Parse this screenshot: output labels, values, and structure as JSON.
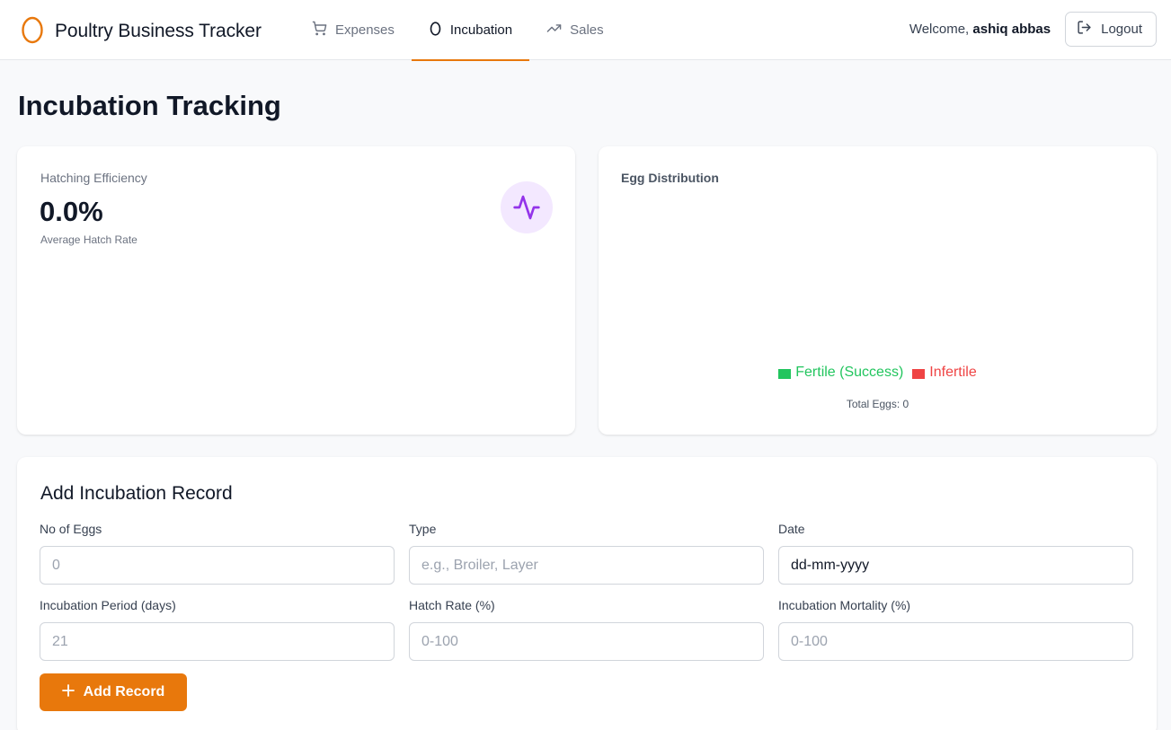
{
  "app": {
    "title": "Poultry Business Tracker"
  },
  "nav": {
    "items": [
      {
        "label": "Expenses",
        "icon": "cart-icon"
      },
      {
        "label": "Incubation",
        "icon": "egg-icon",
        "active": true
      },
      {
        "label": "Sales",
        "icon": "trending-up-icon"
      }
    ]
  },
  "user": {
    "welcome_prefix": "Welcome,",
    "name": "ashiq abbas",
    "logout_label": "Logout"
  },
  "page": {
    "title": "Incubation Tracking"
  },
  "efficiency": {
    "label": "Hatching Efficiency",
    "value": "0.0%",
    "sub": "Average Hatch Rate",
    "icon": "activity-icon"
  },
  "distribution": {
    "title": "Egg Distribution",
    "legend": [
      {
        "label": "Fertile (Success)",
        "color": "#22c55e"
      },
      {
        "label": "Infertile",
        "color": "#ef4444"
      }
    ],
    "total_text": "Total Eggs: 0"
  },
  "form": {
    "title": "Add Incubation Record",
    "fields": [
      {
        "label": "No of Eggs",
        "placeholder": "0"
      },
      {
        "label": "Type",
        "placeholder": "e.g., Broiler, Layer"
      },
      {
        "label": "Date",
        "value": "dd-mm-yyyy"
      },
      {
        "label": "Incubation Period (days)",
        "placeholder": "21"
      },
      {
        "label": "Hatch Rate (%)",
        "placeholder": "0-100"
      },
      {
        "label": "Incubation Mortality (%)",
        "placeholder": "0-100"
      }
    ],
    "submit_label": "Add Record"
  },
  "colors": {
    "accent": "#e8780c",
    "purple": "#9333ea",
    "purple_bg": "#f3e8ff"
  }
}
